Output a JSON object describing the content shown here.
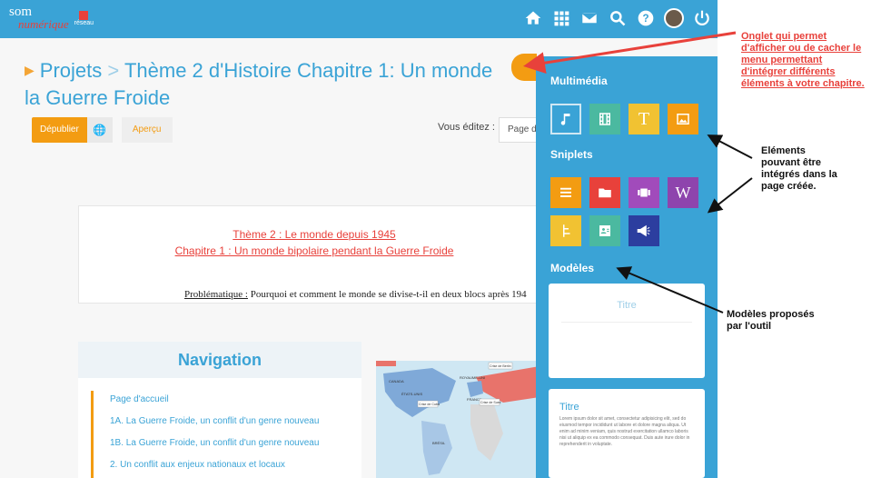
{
  "header": {
    "logo_main": "som",
    "logo_accent": "numérique",
    "logo_network": "réseau",
    "icons": [
      "home-icon",
      "apps-grid-icon",
      "mail-icon",
      "search-icon",
      "help-icon",
      "avatar",
      "power-icon"
    ]
  },
  "breadcrumb": {
    "root": "Projets",
    "separator": ">",
    "current": "Thème 2 d'Histoire Chapitre 1: Un monde",
    "current_line2": "la Guerre Froide"
  },
  "toolbar": {
    "depublish_label": "Dépublier",
    "preview_label": "Aperçu",
    "editing_label": "Vous éditez :",
    "editing_value": "Page d"
  },
  "document": {
    "title_line1": "Thème 2 : Le monde depuis 1945",
    "title_line2": "Chapitre 1 : Un monde bipolaire pendant la Guerre Froide",
    "problem_label": "Problématique :",
    "problem_text": " Pourquoi et comment le monde se divise-t-il en deux blocs après 194"
  },
  "navigation": {
    "title": "Navigation",
    "items": [
      "Page d'accueil",
      "1A. La Guerre Froide, un conflit d'un genre nouveau",
      "1B. La Guerre Froide, un conflit d'un genre nouveau",
      "2. Un conflit aux enjeux nationaux et locaux"
    ]
  },
  "map": {
    "labels": [
      "CANADA",
      "ÉTATS-UNIS",
      "BRÉSIL",
      "FRANCE",
      "ROYAUME-UNI",
      "Crise de Cuba",
      "Crise de Suez",
      "Crise de Berlin"
    ]
  },
  "panel": {
    "multimedia_title": "Multimédia",
    "multimedia_tiles": [
      {
        "icon": "music-note-icon",
        "color": "#3aa3d6"
      },
      {
        "icon": "film-icon",
        "color": "#4bb9a0"
      },
      {
        "icon": "text-icon",
        "label": "T",
        "color": "#f1c232"
      },
      {
        "icon": "image-icon",
        "color": "#f39c12"
      }
    ],
    "sniplets_title": "Sniplets",
    "sniplet_tiles": [
      {
        "icon": "list-icon",
        "color": "#f39c12"
      },
      {
        "icon": "folder-icon",
        "color": "#e8413b"
      },
      {
        "icon": "slides-icon",
        "color": "#a14bbb"
      },
      {
        "icon": "wikipedia-icon",
        "label": "W",
        "color": "#8e44ad"
      },
      {
        "icon": "timeline-icon",
        "color": "#f1c232"
      },
      {
        "icon": "contact-card-icon",
        "color": "#4bb9a0"
      },
      {
        "icon": "megaphone-icon",
        "color": "#2c3e9f"
      }
    ],
    "models_title": "Modèles",
    "model1_title": "Titre",
    "model2_title": "Titre",
    "model2_body": "Lorem ipsum dolor sit amet, consectetur adipisicing elit, sed do eiusmod tempor incididunt ut labore et dolore magna aliqua. Ut enim ad minim veniam, quis nostrud exercitation ullamco laboris nisi ut aliquip ex ea commodo consequat. Duis aute irure dolor in reprehenderit in voluptate."
  },
  "annotations": {
    "tab_note": [
      "Onglet qui permet",
      "d'afficher ou de cacher le",
      "menu permettant",
      "d'intégrer différents",
      "éléments à votre chapitre."
    ],
    "elements_note": [
      "Eléments",
      "pouvant être",
      "intégrés dans la",
      "page créée."
    ],
    "models_note": [
      "Modèles proposés",
      "par l'outil"
    ]
  }
}
